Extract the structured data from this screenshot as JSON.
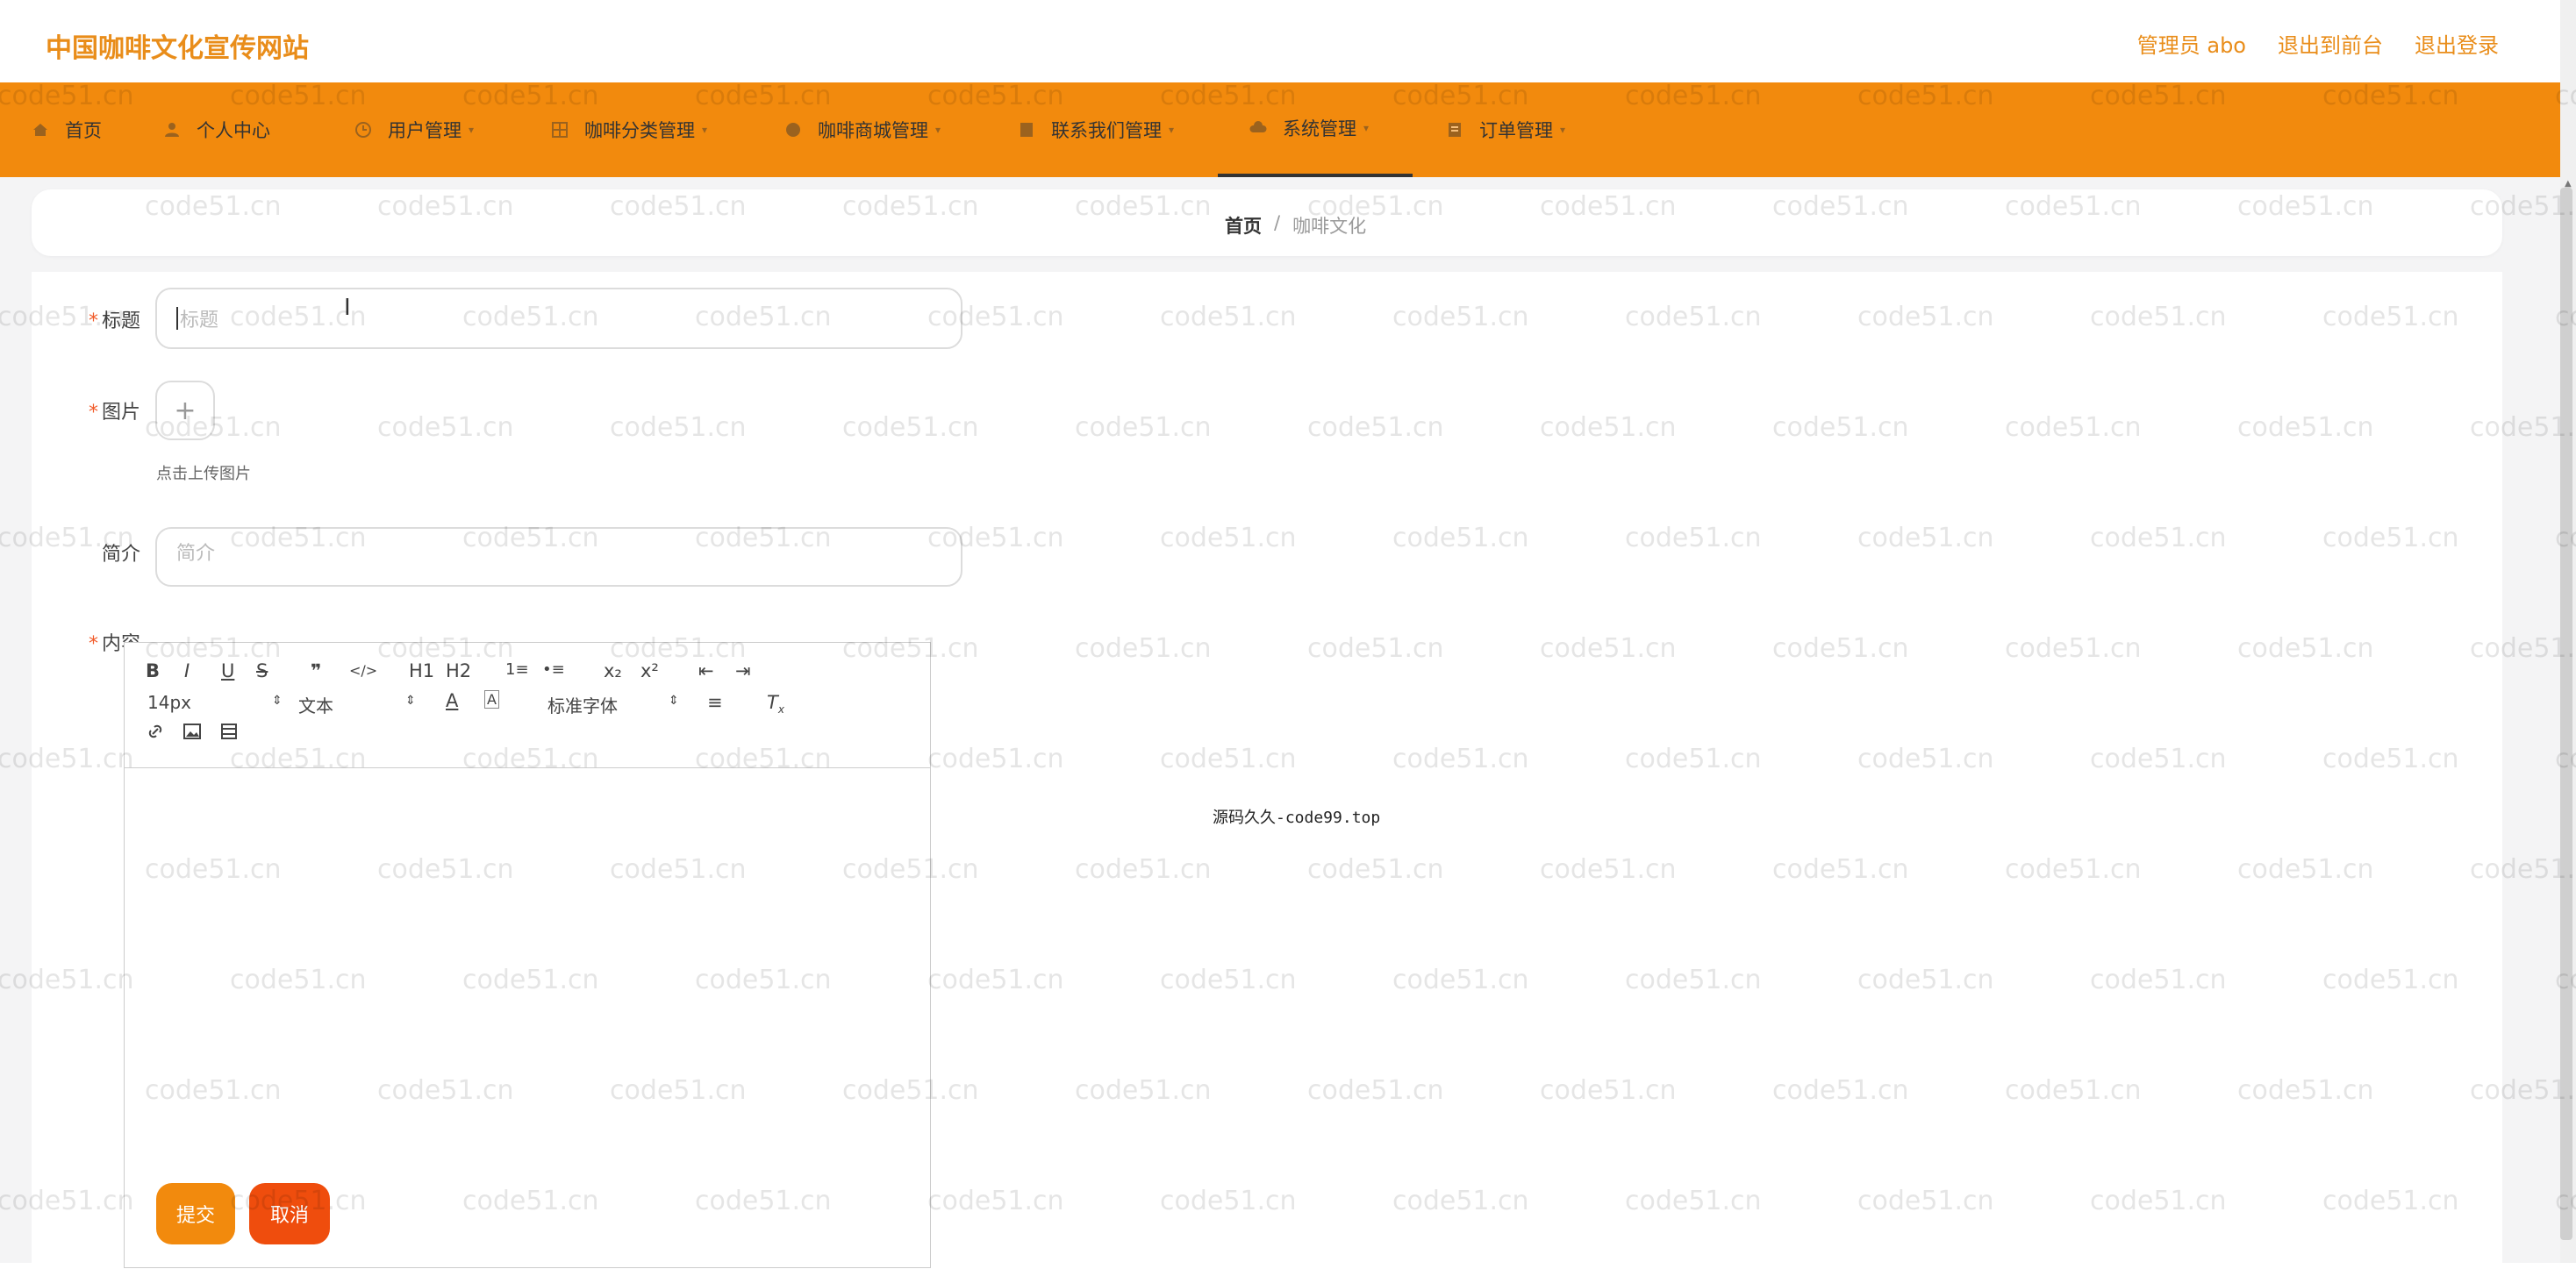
{
  "app": {
    "brand": "中国咖啡文化宣传网站"
  },
  "colors": {
    "primary": "#f28a0d",
    "brand_text": "#e98d1a",
    "cancel": "#ef4d0d",
    "require": "#f15b2a"
  },
  "header": {
    "user": "管理员 abo",
    "front": "退出到前台",
    "logout": "退出登录"
  },
  "nav": [
    {
      "label": "首页",
      "icon": "home-icon"
    },
    {
      "label": "个人中心",
      "icon": "user-icon"
    },
    {
      "label": "用户管理",
      "icon": "clock-icon"
    },
    {
      "label": "咖啡分类管理",
      "icon": "grid-icon"
    },
    {
      "label": "咖啡商城管理",
      "icon": "circle-icon"
    },
    {
      "label": "联系我们管理",
      "icon": "doc-icon"
    },
    {
      "label": "系统管理",
      "icon": "cloud-icon",
      "active": true
    },
    {
      "label": "订单管理",
      "icon": "list-icon"
    }
  ],
  "breadcrumb": {
    "home": "首页",
    "sep": "/",
    "current": "咖啡文化"
  },
  "form": {
    "title_label": "标题",
    "title_placeholder": "标题",
    "image_label": "图片",
    "upload_plus": "+",
    "upload_hint": "点击上传图片",
    "summary_label": "简介",
    "summary_placeholder": "简介",
    "content_label": "内容"
  },
  "editor": {
    "toolbar": [
      "B",
      "I",
      "U",
      "S",
      "❞",
      "</>",
      "H1",
      "H2",
      "1≡",
      "•≡",
      "x₂",
      "x²",
      "⇤",
      "⇥"
    ],
    "font_size": "14px",
    "format": "文本",
    "font": "标准字体"
  },
  "overlay": "源码久久-code99.top",
  "buttons": {
    "submit": "提交",
    "cancel": "取消"
  },
  "watermark": "code51.cn"
}
